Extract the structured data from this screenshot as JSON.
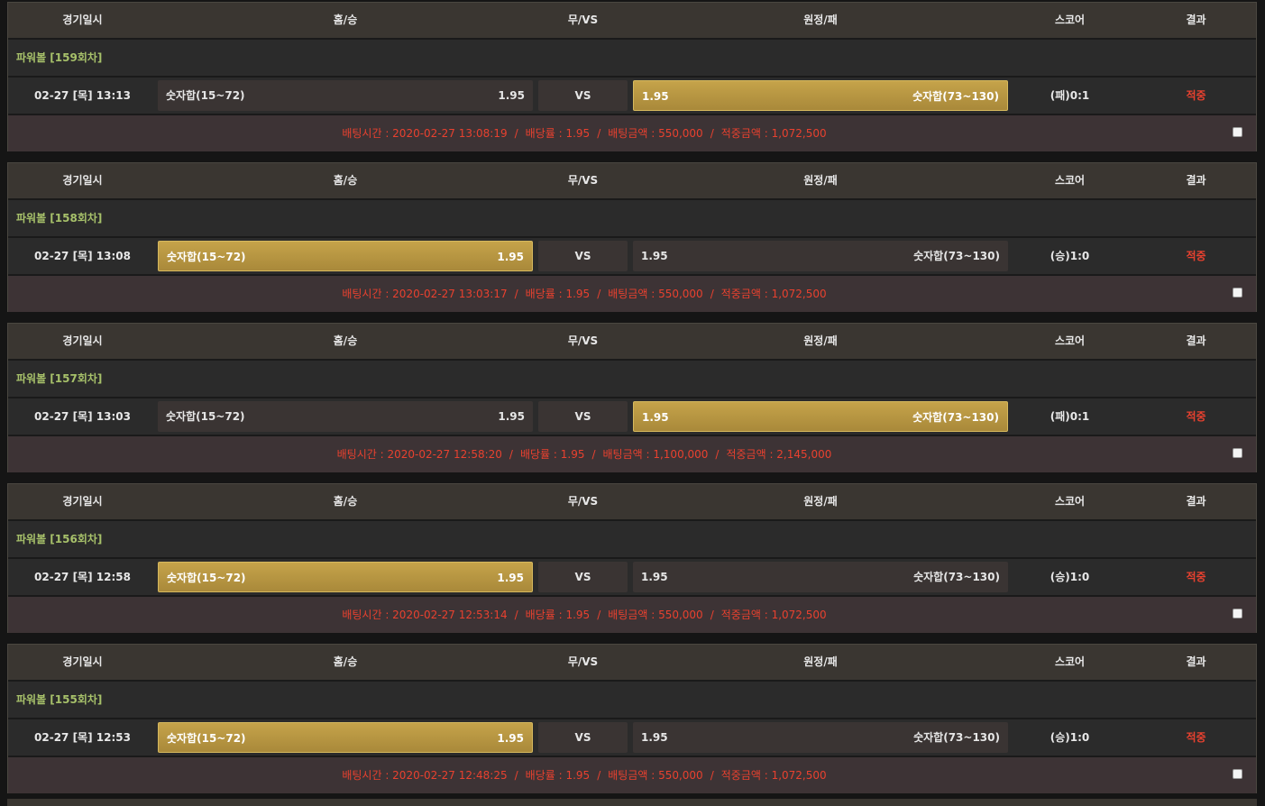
{
  "headers": {
    "date": "경기일시",
    "home": "홈/승",
    "draw": "무/VS",
    "away": "원정/패",
    "score": "스코어",
    "result": "결과"
  },
  "bets": [
    {
      "round": "파워볼 [159회차]",
      "date": "02-27 [목] 13:13",
      "home_label": "숫자합(15~72)",
      "home_odds": "1.95",
      "vs": "VS",
      "away_odds": "1.95",
      "away_label": "숫자합(73~130)",
      "selected": "away",
      "score": "(패)0:1",
      "result": "적중",
      "bet_time": "배팅시간 : 2020-02-27 13:08:19",
      "odds": "배당률 : 1.95",
      "amount": "배팅금액 : 550,000",
      "payout": "적중금액 : 1,072,500"
    },
    {
      "round": "파워볼 [158회차]",
      "date": "02-27 [목] 13:08",
      "home_label": "숫자합(15~72)",
      "home_odds": "1.95",
      "vs": "VS",
      "away_odds": "1.95",
      "away_label": "숫자합(73~130)",
      "selected": "home",
      "score": "(승)1:0",
      "result": "적중",
      "bet_time": "배팅시간 : 2020-02-27 13:03:17",
      "odds": "배당률 : 1.95",
      "amount": "배팅금액 : 550,000",
      "payout": "적중금액 : 1,072,500"
    },
    {
      "round": "파워볼 [157회차]",
      "date": "02-27 [목] 13:03",
      "home_label": "숫자합(15~72)",
      "home_odds": "1.95",
      "vs": "VS",
      "away_odds": "1.95",
      "away_label": "숫자합(73~130)",
      "selected": "away",
      "score": "(패)0:1",
      "result": "적중",
      "bet_time": "배팅시간 : 2020-02-27 12:58:20",
      "odds": "배당률 : 1.95",
      "amount": "배팅금액 : 1,100,000",
      "payout": "적중금액 : 2,145,000"
    },
    {
      "round": "파워볼 [156회차]",
      "date": "02-27 [목] 12:58",
      "home_label": "숫자합(15~72)",
      "home_odds": "1.95",
      "vs": "VS",
      "away_odds": "1.95",
      "away_label": "숫자합(73~130)",
      "selected": "home",
      "score": "(승)1:0",
      "result": "적중",
      "bet_time": "배팅시간 : 2020-02-27 12:53:14",
      "odds": "배당률 : 1.95",
      "amount": "배팅금액 : 550,000",
      "payout": "적중금액 : 1,072,500"
    },
    {
      "round": "파워볼 [155회차]",
      "date": "02-27 [목] 12:53",
      "home_label": "숫자합(15~72)",
      "home_odds": "1.95",
      "vs": "VS",
      "away_odds": "1.95",
      "away_label": "숫자합(73~130)",
      "selected": "home",
      "score": "(승)1:0",
      "result": "적중",
      "bet_time": "배팅시간 : 2020-02-27 12:48:25",
      "odds": "배당률 : 1.95",
      "amount": "배팅금액 : 550,000",
      "payout": "적중금액 : 1,072,500"
    }
  ],
  "separator": "/",
  "colors": {
    "selected_button": "#b8963f",
    "result_red": "#e8412f",
    "round_green": "#a7c16a",
    "header_bg": "#3a3631",
    "info_bg": "#3d3335"
  }
}
